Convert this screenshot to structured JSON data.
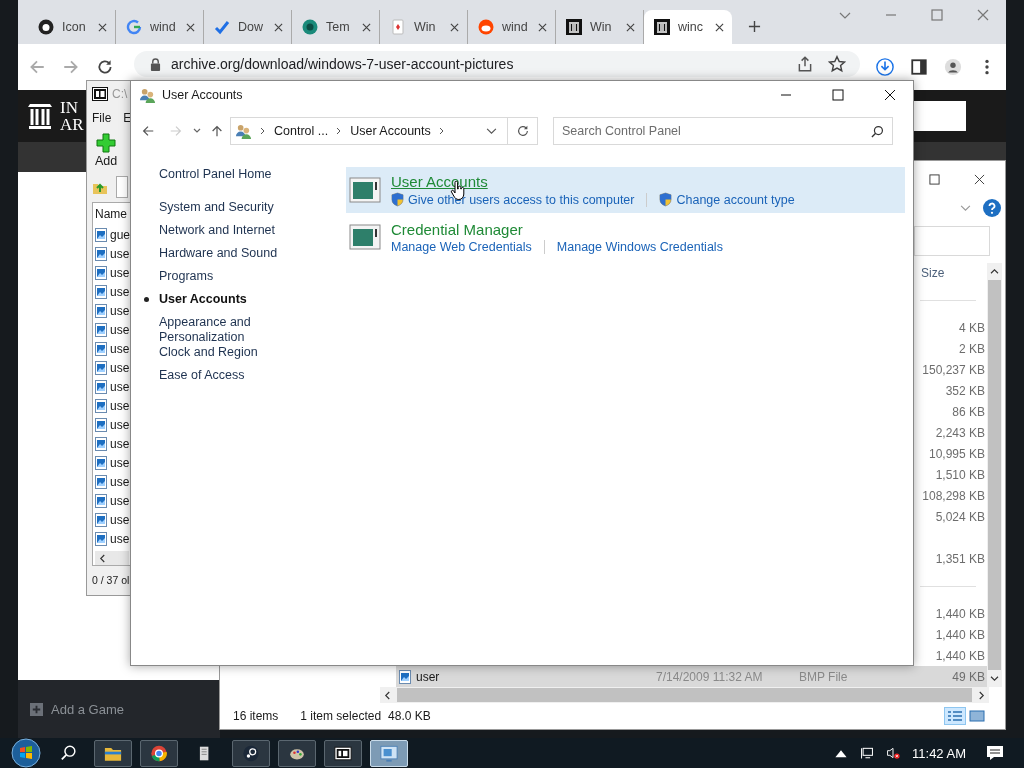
{
  "browser": {
    "tabs": [
      {
        "kind": "github",
        "title": "Icon",
        "selected": false
      },
      {
        "kind": "google",
        "title": "wind",
        "selected": false
      },
      {
        "kind": "check",
        "title": "Dow",
        "selected": false
      },
      {
        "kind": "teal",
        "title": "Tem",
        "selected": false
      },
      {
        "kind": "card",
        "title": "Win",
        "selected": false
      },
      {
        "kind": "reddit",
        "title": "wind",
        "selected": false
      },
      {
        "kind": "museum",
        "title": "Win",
        "selected": false
      },
      {
        "kind": "museum",
        "title": "winc",
        "selected": true
      }
    ],
    "url": "archive.org/download/windows-7-user-account-pictures",
    "logo_lines": [
      "IN",
      "AR"
    ]
  },
  "steam": {
    "add_game": "Add a Game"
  },
  "archiver": {
    "title": "C:\\",
    "menu": [
      "File",
      "E"
    ],
    "add": "Add",
    "column": "Name",
    "files": [
      "gue",
      "use",
      "use",
      "use",
      "use",
      "use",
      "use",
      "use",
      "use",
      "use",
      "use",
      "use",
      "use",
      "use",
      "use",
      "use",
      "use"
    ],
    "status": "0 / 37 ol"
  },
  "explorer": {
    "column": "Size",
    "rows": [
      {
        "kind": "divider"
      },
      {
        "kind": "size",
        "size": "4 KB",
        "selected": false
      },
      {
        "kind": "size",
        "size": "2 KB",
        "selected": false
      },
      {
        "kind": "size",
        "size": "150,237 KB",
        "selected": false
      },
      {
        "kind": "size",
        "size": "352 KB",
        "selected": false
      },
      {
        "kind": "size",
        "size": "86 KB",
        "selected": false
      },
      {
        "kind": "size",
        "size": "2,243 KB",
        "selected": false
      },
      {
        "kind": "size",
        "size": "10,995 KB",
        "selected": false
      },
      {
        "kind": "size",
        "size": "1,510 KB",
        "selected": false
      },
      {
        "kind": "size",
        "size": "108,298 KB",
        "selected": false
      },
      {
        "kind": "size",
        "size": "5,024 KB",
        "selected": false
      },
      {
        "kind": "blank"
      },
      {
        "kind": "size",
        "size": "1,351 KB",
        "selected": false
      },
      {
        "kind": "divider"
      },
      {
        "kind": "size",
        "size": "1,440 KB",
        "selected": false
      },
      {
        "kind": "size",
        "size": "1,440 KB",
        "selected": false
      },
      {
        "kind": "size",
        "size": "1,440 KB",
        "selected": false
      },
      {
        "kind": "file",
        "name": "user",
        "date": "7/14/2009 11:32 AM",
        "type": "BMP File",
        "size": "49 KB",
        "selected": true
      }
    ],
    "status": {
      "count": "16 items",
      "selection": "1 item selected",
      "size": "48.0 KB"
    }
  },
  "control_panel": {
    "title": "User Accounts",
    "breadcrumb": [
      "Control ...",
      "User Accounts"
    ],
    "search": {
      "placeholder": "Search Control Panel"
    },
    "nav": [
      {
        "label": "Control Panel Home",
        "kind": "home",
        "selected": false
      },
      {
        "label": "System and Security",
        "kind": "category",
        "selected": false
      },
      {
        "label": "Network and Internet",
        "kind": "category",
        "selected": false
      },
      {
        "label": "Hardware and Sound",
        "kind": "category",
        "selected": false
      },
      {
        "label": "Programs",
        "kind": "category",
        "selected": false
      },
      {
        "label": "User Accounts",
        "kind": "category",
        "selected": true
      },
      {
        "label": "Appearance and Personalization",
        "kind": "category",
        "selected": false
      },
      {
        "label": "Clock and Region",
        "kind": "category",
        "selected": false
      },
      {
        "label": "Ease of Access",
        "kind": "category",
        "selected": false
      }
    ],
    "categories": [
      {
        "title": "User Accounts",
        "hovered": true,
        "links": [
          {
            "label": "Give other users access to this computer",
            "shield": true
          },
          {
            "label": "Change account type",
            "shield": true
          }
        ]
      },
      {
        "title": "Credential Manager",
        "hovered": false,
        "links": [
          {
            "label": "Manage Web Credentials",
            "shield": false
          },
          {
            "label": "Manage Windows Credentials",
            "shield": false
          }
        ]
      }
    ]
  },
  "taskbar": {
    "apps": [
      {
        "kind": "explorer",
        "active": false
      },
      {
        "kind": "chrome",
        "active": false
      },
      {
        "kind": "document",
        "active": false
      },
      {
        "kind": "steam",
        "active": false
      },
      {
        "kind": "paint",
        "active": false
      },
      {
        "kind": "archiver",
        "active": false
      },
      {
        "kind": "control-panel",
        "active": true
      }
    ],
    "clock": "11:42 AM"
  }
}
